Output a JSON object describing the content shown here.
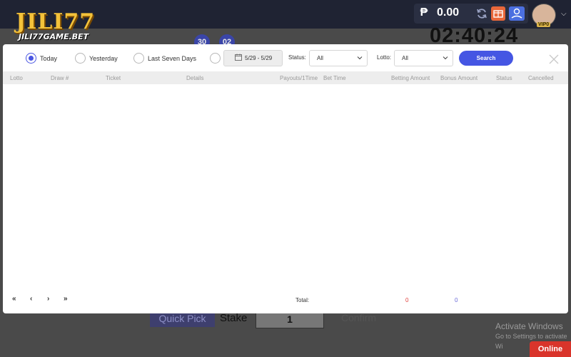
{
  "background": {
    "brand": {
      "logo_main": "JILI77",
      "logo_sub": "JILI77GAME.BET"
    },
    "balance": {
      "currency_symbol": "₱",
      "amount": "0.00"
    },
    "vip_badge": "VIP0",
    "draw_numbers": [
      "30",
      "02"
    ],
    "countdown": "02:40:24",
    "bet_panel": {
      "quick_pick": "Quick Pick",
      "stake_label": "Stake",
      "stake_value": "1",
      "confirm": "Confirm"
    },
    "watermark": {
      "title": "Activate Windows",
      "subtitle": "Go to Settings to activate Wi"
    },
    "online_button": "Online"
  },
  "modal": {
    "filters": {
      "range_options": [
        {
          "label": "Today",
          "selected": true
        },
        {
          "label": "Yesterday",
          "selected": false
        },
        {
          "label": "Last Seven Days",
          "selected": false
        }
      ],
      "custom_range_selected": false,
      "date_range": "5/29 - 5/29",
      "status_label": "Status:",
      "status_value": "All",
      "lotto_label": "Lotto:",
      "lotto_value": "All",
      "search_button": "Search"
    },
    "columns": [
      "Lotto",
      "Draw #",
      "Ticket",
      "Details",
      "Payouts/1Time",
      "Bet Time",
      "Betting Amount",
      "Bonus Amount",
      "Status",
      "Cancelled"
    ],
    "rows": [],
    "pager": {
      "first": "«",
      "prev": "‹",
      "next": "›",
      "last": "»"
    },
    "totals": {
      "label": "Total:",
      "betting_amount": "0",
      "bonus_amount": "0"
    },
    "colors": {
      "accent": "#4556e3",
      "bet_total": "#e0413d",
      "bonus_total": "#6a6ad8"
    }
  }
}
